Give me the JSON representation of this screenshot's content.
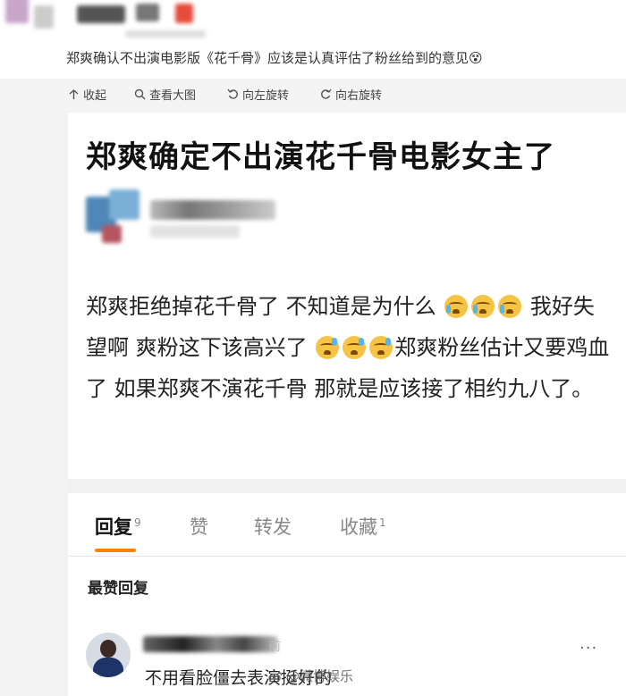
{
  "caption": "郑爽确认不出演电影版《花千骨》应该是认真评估了粉丝给到的意见😵",
  "toolbar": {
    "collapse": "收起",
    "view_large": "查看大图",
    "rotate_left": "向左旋转",
    "rotate_right": "向右旋转"
  },
  "post": {
    "title": "郑爽确定不出演花千骨电影女主了",
    "body_1": "郑爽拒绝掉花千骨了 不知道是为什么",
    "body_2": " 我好失望啊 爽粉这下该高兴了",
    "body_3": "郑爽粉丝估计又要鸡血了 如果郑爽不演花千骨 那就是应该接了相约九八了。"
  },
  "tabs": {
    "reply_label": "回复",
    "reply_count": "9",
    "like_label": "赞",
    "repost_label": "转发",
    "fav_label": "收藏",
    "fav_count": "1"
  },
  "replies": {
    "section_title": "最赞回复",
    "items": [
      {
        "time_suffix": "前",
        "text": "不用看脸僵去表演挺好的",
        "more": "···"
      }
    ]
  },
  "watermark": "@微博娱乐",
  "icons": [
    "collapse-icon",
    "search-icon",
    "rotate-left-icon",
    "rotate-right-icon",
    "crying-emoji",
    "sweat-emoji",
    "more-icon",
    "weibo-icon"
  ],
  "colors": {
    "accent": "#ff8200",
    "bg": "#f3f3f3"
  }
}
